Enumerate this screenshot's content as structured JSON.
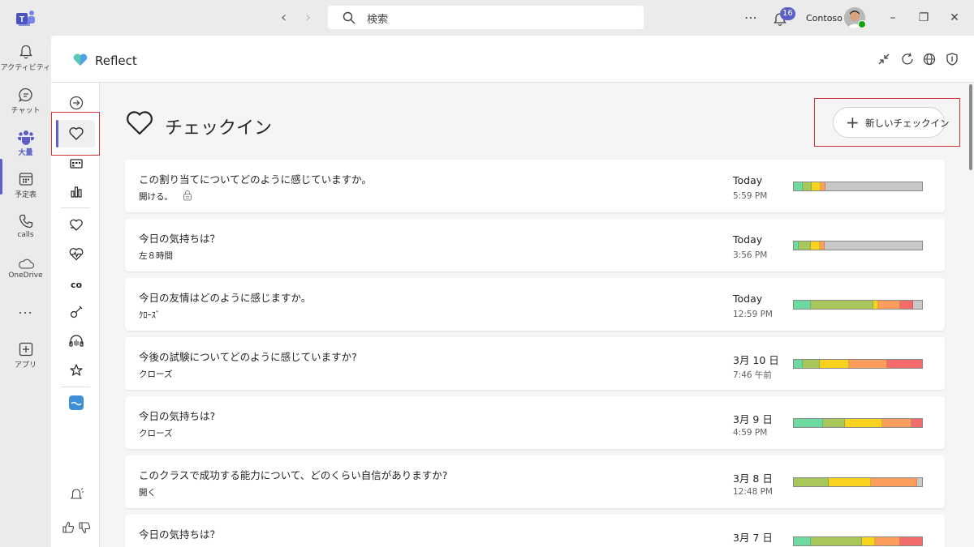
{
  "titlebar": {
    "search_placeholder": "検索",
    "notification_count": "16",
    "org_name": "Contoso"
  },
  "rail": {
    "items": [
      {
        "label": "アクティビティ",
        "icon": "bell-icon"
      },
      {
        "label": "チャット",
        "icon": "chat-icon"
      },
      {
        "label": "大量",
        "icon": "teams-icon"
      },
      {
        "label": "予定表",
        "icon": "calendar-icon"
      },
      {
        "label": "calls",
        "icon": "phone-icon"
      },
      {
        "label": "OneDrive",
        "icon": "cloud-icon"
      },
      {
        "label": "アプリ",
        "icon": "plus-square-icon"
      }
    ],
    "more_label": "..."
  },
  "app": {
    "name": "Reflect"
  },
  "sidebar": {
    "co_label": "co"
  },
  "page": {
    "title": "チェックイン",
    "new_button_label": "新しいチェックイン"
  },
  "colors": {
    "accent": "#5b5fc7",
    "highlight_box": "#d13438",
    "green": "#6ed9a0",
    "light_green": "#a8c75a",
    "yellow": "#f7d21e",
    "orange": "#fd9d5d",
    "red": "#f26c6c",
    "gray": "#c8c8c8"
  },
  "checkins": [
    {
      "question": "この割り当てについてどのように感じていますか。",
      "status": "開ける。",
      "locked": true,
      "date": "Today",
      "time": "5:59 PM",
      "segments": [
        [
          "#6ed9a0",
          0.07
        ],
        [
          "#a8c75a",
          0.07
        ],
        [
          "#f7d21e",
          0.07
        ],
        [
          "#fd9d5d",
          0.04
        ],
        [
          "#c8c8c8",
          0.75
        ]
      ]
    },
    {
      "question": "今日の気持ちは？",
      "status": "左８時間",
      "locked": false,
      "date": "Today",
      "time": "3:56 PM",
      "segments": [
        [
          "#6ed9a0",
          0.04
        ],
        [
          "#a8c75a",
          0.09
        ],
        [
          "#f7d21e",
          0.07
        ],
        [
          "#fd9d5d",
          0.04
        ],
        [
          "#c8c8c8",
          0.76
        ]
      ]
    },
    {
      "question": "今日の友情はどのように感じますか。",
      "status": "ｸﾛｰｽﾞ",
      "locked": false,
      "date": "Today",
      "time": "12:59 PM",
      "segments": [
        [
          "#6ed9a0",
          0.13
        ],
        [
          "#a8c75a",
          0.49
        ],
        [
          "#f7d21e",
          0.04
        ],
        [
          "#fd9d5d",
          0.17
        ],
        [
          "#f26c6c",
          0.1
        ],
        [
          "#c8c8c8",
          0.07
        ]
      ]
    },
    {
      "question": "今後の試験についてどのように感じていますか?",
      "status": "クローズ",
      "locked": false,
      "date": "3月 10 日",
      "time": "7:46 午前",
      "segments": [
        [
          "#6ed9a0",
          0.07
        ],
        [
          "#a8c75a",
          0.13
        ],
        [
          "#f7d21e",
          0.23
        ],
        [
          "#fd9d5d",
          0.3
        ],
        [
          "#f26c6c",
          0.27
        ]
      ]
    },
    {
      "question": "今日の気持ちは?",
      "status": "クローズ",
      "locked": false,
      "date": "3月 9 日",
      "time": "4:59 PM",
      "segments": [
        [
          "#6ed9a0",
          0.23
        ],
        [
          "#a8c75a",
          0.17
        ],
        [
          "#f7d21e",
          0.29
        ],
        [
          "#fd9d5d",
          0.23
        ],
        [
          "#f26c6c",
          0.08
        ]
      ]
    },
    {
      "question": "このクラスで成功する能力について、どのくらい自信がありますか?",
      "status": "開く",
      "locked": false,
      "date": "3月 8 日",
      "time": "12:48 PM",
      "segments": [
        [
          "#a8c75a",
          0.27
        ],
        [
          "#f7d21e",
          0.33
        ],
        [
          "#fd9d5d",
          0.36
        ],
        [
          "#c8c8c8",
          0.04
        ]
      ]
    },
    {
      "question": "今日の気持ちは？",
      "status": "",
      "locked": false,
      "date": "3月 7 日",
      "time": "",
      "segments": [
        [
          "#6ed9a0",
          0.13
        ],
        [
          "#a8c75a",
          0.4
        ],
        [
          "#f7d21e",
          0.1
        ],
        [
          "#fd9d5d",
          0.2
        ],
        [
          "#f26c6c",
          0.17
        ]
      ]
    }
  ]
}
